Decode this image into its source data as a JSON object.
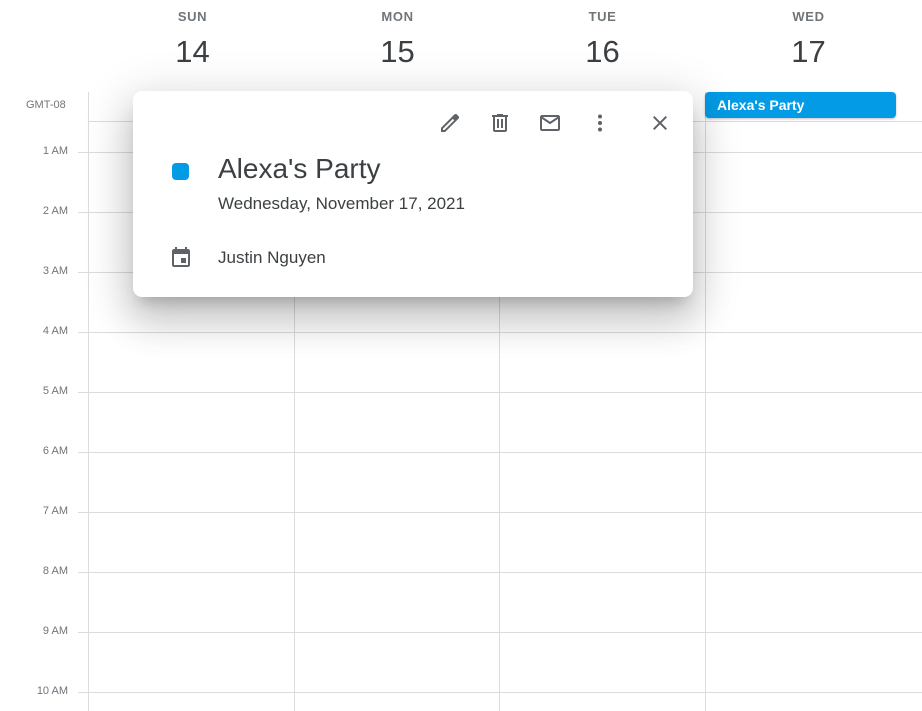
{
  "timezone": "GMT-08",
  "days": [
    {
      "dow": "SUN",
      "date": "14"
    },
    {
      "dow": "MON",
      "date": "15"
    },
    {
      "dow": "TUE",
      "date": "16"
    },
    {
      "dow": "WED",
      "date": "17"
    }
  ],
  "hours": [
    "1 AM",
    "2 AM",
    "3 AM",
    "4 AM",
    "5 AM",
    "6 AM",
    "7 AM",
    "8 AM",
    "9 AM",
    "10 AM"
  ],
  "allday_event": {
    "title": "Alexa's Party",
    "color": "#039be5"
  },
  "popup": {
    "toolbar": [
      "edit-icon",
      "delete-icon",
      "email-icon",
      "more-options-icon",
      "close-icon"
    ],
    "title": "Alexa's Party",
    "date": "Wednesday, November 17, 2021",
    "owner": "Justin Nguyen",
    "color": "#039be5"
  }
}
